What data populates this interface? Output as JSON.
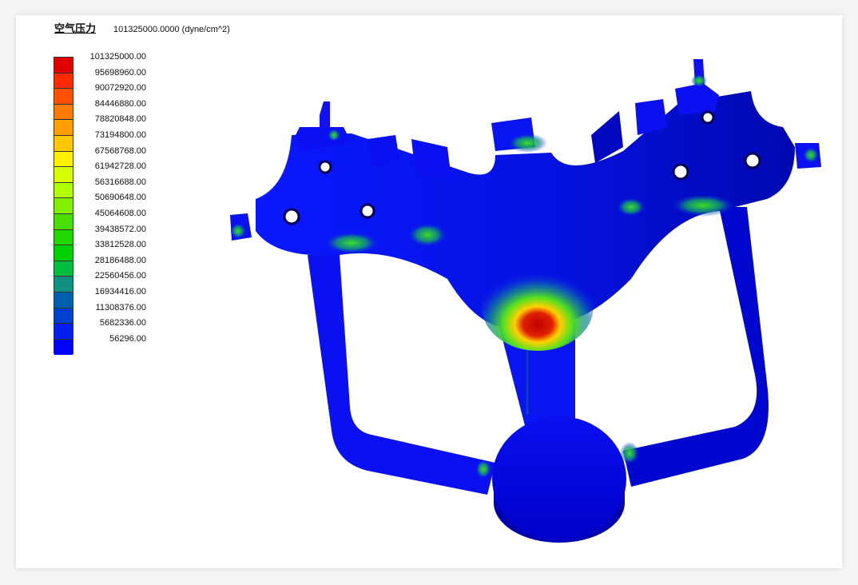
{
  "header": {
    "result_name": "空气压力",
    "result_value": "101325000.0000 (dyne/cm^2)"
  },
  "legend": {
    "labels": [
      "101325000.00",
      "95698960.00",
      "90072920.00",
      "84446880.00",
      "78820848.00",
      "73194800.00",
      "67568768.00",
      "61942728.00",
      "56316688.00",
      "50690648.00",
      "45064608.00",
      "39438572.00",
      "33812528.00",
      "28186488.00",
      "22560456.00",
      "16934416.00",
      "11308376.00",
      "5682336.00",
      "56296.00"
    ],
    "colors": [
      "#e00000",
      "#ff2a00",
      "#ff5000",
      "#ff7a00",
      "#ff9e00",
      "#ffc800",
      "#fff000",
      "#d8ff00",
      "#b0ff00",
      "#80f000",
      "#48e000",
      "#20d800",
      "#00d000",
      "#00c040",
      "#109080",
      "#0060b0",
      "#0040d0",
      "#0020f0",
      "#0000ff"
    ]
  },
  "model_colors": {
    "base": "#0a10f0",
    "shade": "#0008b8",
    "hot": "#d00000",
    "warm": "#ffd000",
    "mid": "#20d020"
  }
}
